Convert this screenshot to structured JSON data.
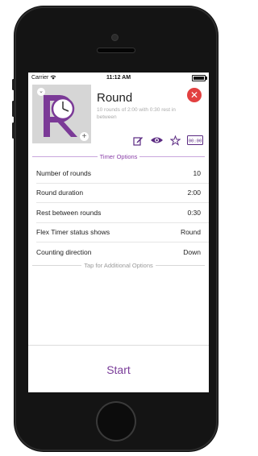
{
  "status_bar": {
    "carrier": "Carrier",
    "time": "11:12 AM"
  },
  "timer": {
    "title": "Round",
    "subtitle": "10 rounds of 2:00 with 0:30 rest in between"
  },
  "sections": {
    "options_label": "Timer Options",
    "additional_label": "Tap for Additional Options"
  },
  "options": [
    {
      "label": "Number of rounds",
      "value": "10"
    },
    {
      "label": "Round duration",
      "value": "2:00"
    },
    {
      "label": "Rest between rounds",
      "value": "0:30"
    },
    {
      "label": "Flex Timer status shows",
      "value": "Round"
    },
    {
      "label": "Counting direction",
      "value": "Down"
    }
  ],
  "actions": {
    "display_label": "00:00"
  },
  "start": {
    "label": "Start"
  },
  "colors": {
    "accent": "#7a3c99",
    "close": "#e24040"
  },
  "icons": [
    "wifi-icon",
    "battery-icon",
    "chevron-down-icon",
    "plus-icon",
    "close-icon",
    "edit-icon",
    "eye-icon",
    "star-icon",
    "display-icon"
  ]
}
